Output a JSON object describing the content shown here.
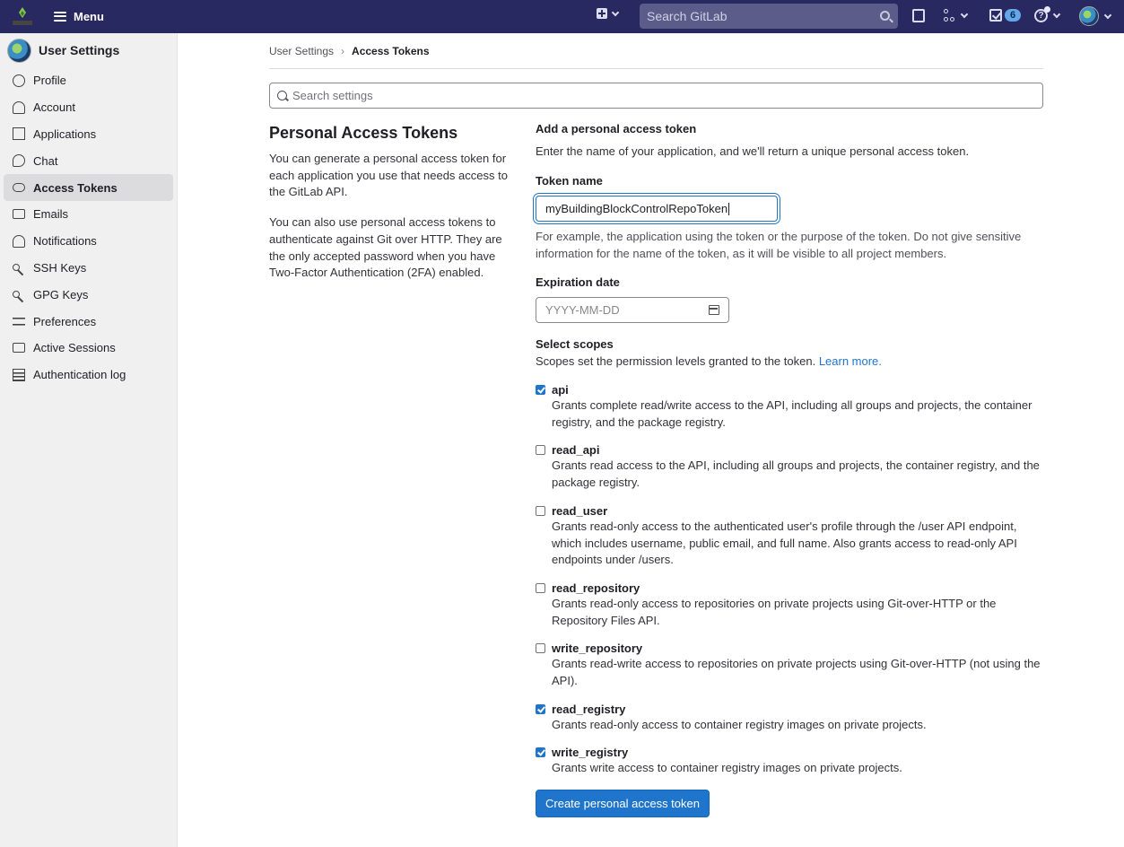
{
  "nav": {
    "menu_label": "Menu",
    "search_placeholder": "Search GitLab",
    "todo_count": "6"
  },
  "sidebar": {
    "title": "User Settings",
    "items": [
      {
        "label": "Profile",
        "icon": "profile-icon"
      },
      {
        "label": "Account",
        "icon": "account-icon"
      },
      {
        "label": "Applications",
        "icon": "applications-icon"
      },
      {
        "label": "Chat",
        "icon": "chat-icon"
      },
      {
        "label": "Access Tokens",
        "icon": "token-icon",
        "active": true
      },
      {
        "label": "Emails",
        "icon": "mail-icon"
      },
      {
        "label": "Notifications",
        "icon": "bell-icon"
      },
      {
        "label": "SSH Keys",
        "icon": "key-icon"
      },
      {
        "label": "GPG Keys",
        "icon": "key-icon"
      },
      {
        "label": "Preferences",
        "icon": "preferences-icon"
      },
      {
        "label": "Active Sessions",
        "icon": "monitor-icon"
      },
      {
        "label": "Authentication log",
        "icon": "log-icon"
      }
    ]
  },
  "breadcrumb": {
    "parent": "User Settings",
    "current": "Access Tokens"
  },
  "settings_search": {
    "placeholder": "Search settings"
  },
  "intro": {
    "title": "Personal Access Tokens",
    "para1": "You can generate a personal access token for each application you use that needs access to the GitLab API.",
    "para2": "You can also use personal access tokens to authenticate against Git over HTTP. They are the only accepted password when you have Two-Factor Authentication (2FA) enabled."
  },
  "form": {
    "heading": "Add a personal access token",
    "description": "Enter the name of your application, and we'll return a unique personal access token.",
    "token_name_label": "Token name",
    "token_name_value": "myBuildingBlockControlRepoToken",
    "token_name_help": "For example, the application using the token or the purpose of the token. Do not give sensitive information for the name of the token, as it will be visible to all project members.",
    "expiration_label": "Expiration date",
    "expiration_placeholder": "YYYY-MM-DD",
    "scopes_label": "Select scopes",
    "scopes_help": "Scopes set the permission levels granted to the token.",
    "learn_more": "Learn more.",
    "submit_label": "Create personal access token"
  },
  "scopes": [
    {
      "name": "api",
      "checked": true,
      "desc": "Grants complete read/write access to the API, including all groups and projects, the container registry, and the package registry."
    },
    {
      "name": "read_api",
      "checked": false,
      "desc": "Grants read access to the API, including all groups and projects, the container registry, and the package registry."
    },
    {
      "name": "read_user",
      "checked": false,
      "desc": "Grants read-only access to the authenticated user's profile through the /user API endpoint, which includes username, public email, and full name. Also grants access to read-only API endpoints under /users."
    },
    {
      "name": "read_repository",
      "checked": false,
      "desc": "Grants read-only access to repositories on private projects using Git-over-HTTP or the Repository Files API."
    },
    {
      "name": "write_repository",
      "checked": false,
      "desc": "Grants read-write access to repositories on private projects using Git-over-HTTP (not using the API)."
    },
    {
      "name": "read_registry",
      "checked": true,
      "desc": "Grants read-only access to container registry images on private projects."
    },
    {
      "name": "write_registry",
      "checked": true,
      "desc": "Grants write access to container registry images on private projects."
    }
  ]
}
